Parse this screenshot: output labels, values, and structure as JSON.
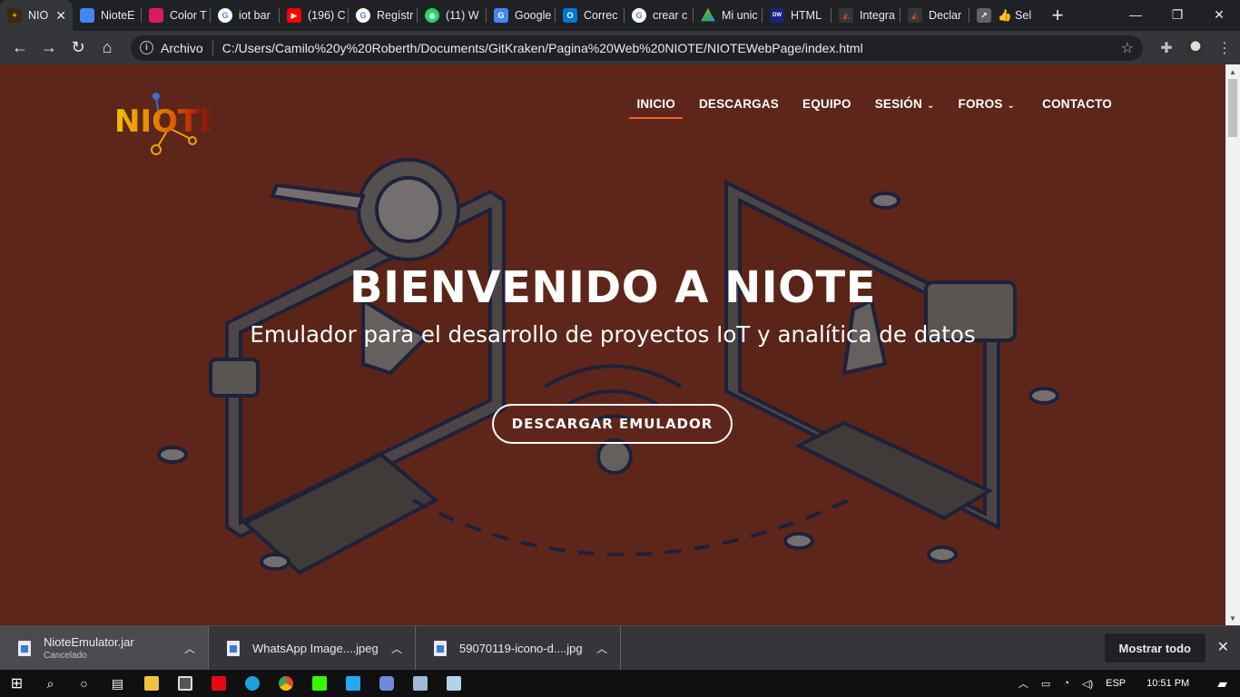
{
  "browser": {
    "tabs": [
      {
        "label": "NIO",
        "color": "#e2a400",
        "active": true
      },
      {
        "label": "NioteE",
        "color": "#4285f4"
      },
      {
        "label": "Color T",
        "color": "#d81b60"
      },
      {
        "label": "iot bar",
        "color": "#ffffff"
      },
      {
        "label": "(196) C",
        "color": "#ff0000"
      },
      {
        "label": "Regístr",
        "color": "#ffffff"
      },
      {
        "label": "(11) W",
        "color": "#25d366"
      },
      {
        "label": "Google",
        "color": "#4285f4"
      },
      {
        "label": "Correc",
        "color": "#0078d4"
      },
      {
        "label": "crear c",
        "color": "#ffffff"
      },
      {
        "label": "Mi unic",
        "color": "#fbbc04"
      },
      {
        "label": "HTML",
        "color": "#1a237e"
      },
      {
        "label": "Integra",
        "color": "#e0462c"
      },
      {
        "label": "Declar",
        "color": "#e0462c"
      },
      {
        "label": "👍 Sel",
        "color": "#5f6368"
      }
    ],
    "omnibox_scheme": "Archivo",
    "url": "C:/Users/Camilo%20y%20Roberth/Documents/GitKraken/Pagina%20Web%20NIOTE/NIOTEWebPage/index.html"
  },
  "site": {
    "logo_text": "NIOTE",
    "nav": [
      {
        "label": "INICIO",
        "active": true
      },
      {
        "label": "DESCARGAS"
      },
      {
        "label": "EQUIPO"
      },
      {
        "label": "SESIÓN",
        "dropdown": true
      },
      {
        "label": "FOROS",
        "dropdown": true
      },
      {
        "label": "CONTACTO"
      }
    ],
    "hero_title": "BIENVENIDO A NIOTE",
    "hero_subtitle": "Emulador para el desarrollo de proyectos IoT y analítica de datos",
    "hero_button": "DESCARGAR EMULADOR",
    "bg_color": "#5e261b",
    "accent_color": "#f15e2a"
  },
  "downloads": {
    "items": [
      {
        "name": "NioteEmulator.jar",
        "status": "Cancelado"
      },
      {
        "name": "WhatsApp Image....jpeg"
      },
      {
        "name": "59070119-icono-d....jpg"
      }
    ],
    "show_all": "Mostrar todo"
  },
  "taskbar": {
    "lang": "ESP",
    "time": "10:51 PM"
  }
}
